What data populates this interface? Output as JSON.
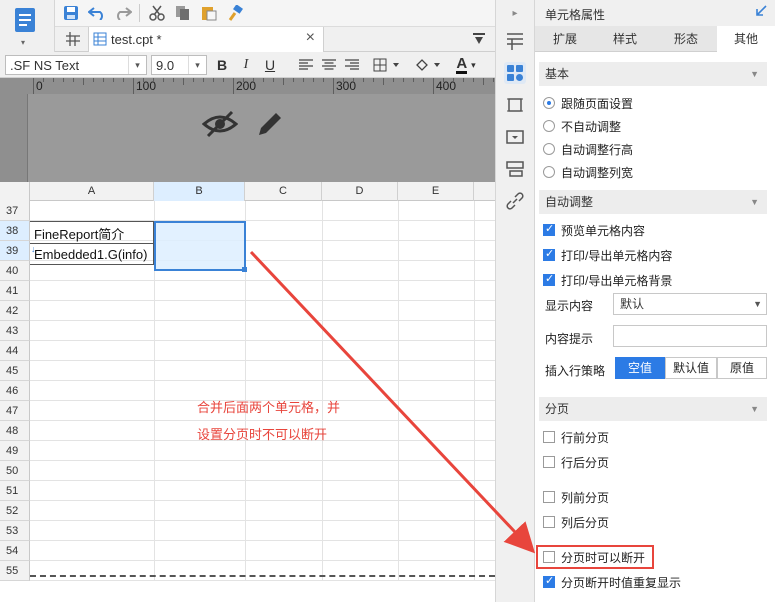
{
  "file_tab": {
    "name": "test.cpt *",
    "close": "×"
  },
  "toolbar": {
    "font_name": ".SF NS Text",
    "font_size": "9.0",
    "bold": "B",
    "italic": "I",
    "underline": "U",
    "font_color_letter": "A"
  },
  "ruler": {
    "labels": [
      "0",
      "100",
      "200",
      "300",
      "400"
    ]
  },
  "grid": {
    "columns": [
      "A",
      "B",
      "C",
      "D",
      "E"
    ],
    "rows": [
      "37",
      "38",
      "39",
      "40",
      "41",
      "42",
      "43",
      "44",
      "45",
      "46",
      "47",
      "48",
      "49",
      "50",
      "51",
      "52",
      "53",
      "54",
      "55"
    ],
    "cells": {
      "A38": "FineReport简介",
      "A39": "Embedded1.G(info)"
    }
  },
  "annotation": {
    "line1": "合并后面两个单元格，并",
    "line2": "设置分页时不可以断开"
  },
  "panel": {
    "title": "单元格属性",
    "tabs": [
      "扩展",
      "样式",
      "形态",
      "其他"
    ],
    "active_tab": "其他",
    "basic": {
      "header": "基本",
      "options": [
        "跟随页面设置",
        "不自动调整",
        "自动调整行高",
        "自动调整列宽"
      ],
      "selected": "跟随页面设置"
    },
    "auto_adjust": {
      "header": "自动调整",
      "checks": [
        "预览单元格内容",
        "打印/导出单元格内容",
        "打印/导出单元格背景"
      ],
      "display_content_label": "显示内容",
      "display_content_value": "默认",
      "content_hint_label": "内容提示",
      "content_hint_value": "",
      "insert_policy_label": "插入行策略",
      "insert_policy_options": [
        "空值",
        "默认值",
        "原值"
      ],
      "insert_policy_selected": "空值"
    },
    "paging": {
      "header": "分页",
      "checks": [
        {
          "label": "行前分页",
          "checked": false
        },
        {
          "label": "行后分页",
          "checked": false
        },
        {
          "label": "列前分页",
          "checked": false
        },
        {
          "label": "列后分页",
          "checked": false
        },
        {
          "label": "分页时可以断开",
          "checked": false
        },
        {
          "label": "分页断开时值重复显示",
          "checked": true
        }
      ]
    }
  },
  "colors": {
    "accent": "#2c7be5",
    "annotation": "#e8453c",
    "selection": "#ddeeff"
  }
}
